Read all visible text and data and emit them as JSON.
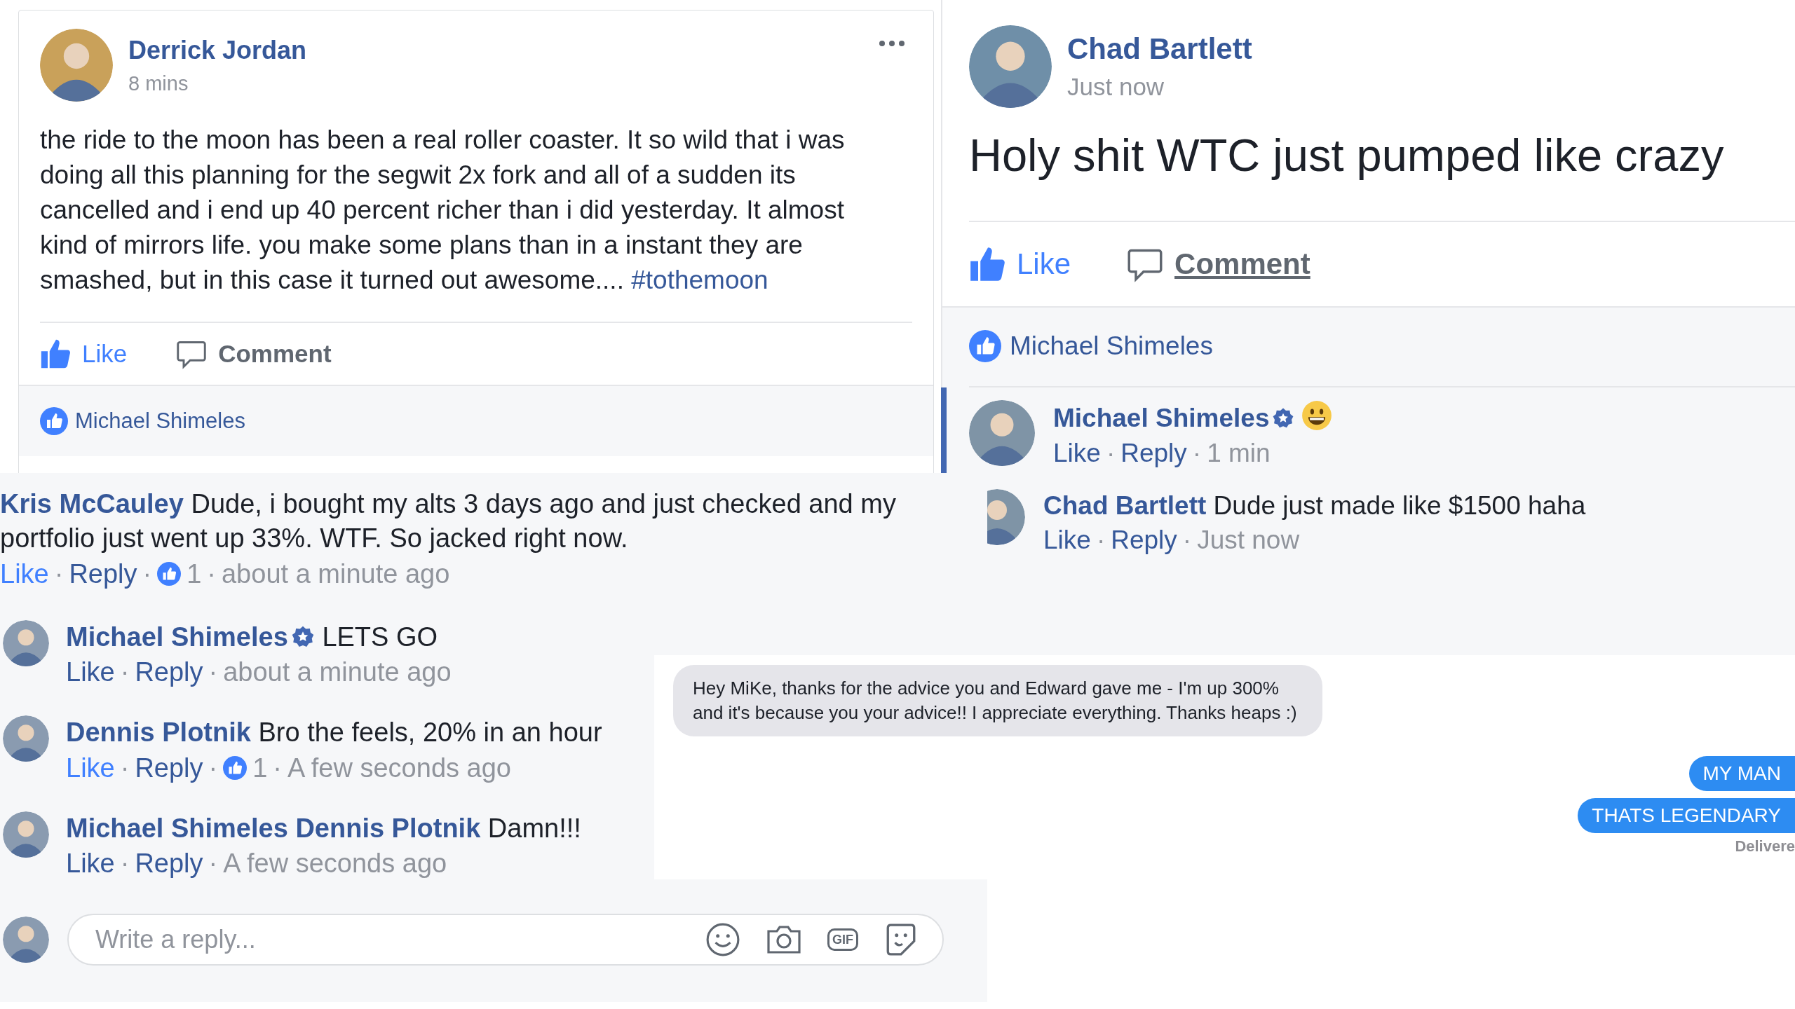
{
  "separator": "·",
  "post_1": {
    "author": "Derrick Jordan",
    "time": "8 mins",
    "text": "the ride to the moon has been a real roller coaster. It so wild that i was doing all this planning for the segwit 2x fork and all of a sudden its cancelled and i end up 40 percent richer than i did yesterday. It almost kind of mirrors life. you make some plans than in a instant they are smashed, but in this case it turned out awesome....",
    "hashtag": "#tothemoon",
    "like_label": "Like",
    "liked": true,
    "comment_label": "Comment",
    "comment_underlined": false,
    "likers": "Michael Shimeles"
  },
  "post_2": {
    "author": "Chad Bartlett",
    "time": "Just now",
    "text": "Holy shit WTC just pumped like crazy",
    "like_label": "Like",
    "liked": true,
    "comment_label": "Comment",
    "comment_underlined": true,
    "likers": "Michael Shimeles",
    "comments": [
      {
        "author": "Michael Shimeles",
        "verified": true,
        "emoji": true,
        "selected": true,
        "like_label": "Like",
        "liked": false,
        "reply_label": "Reply",
        "time": "1 min"
      },
      {
        "author": "Chad Bartlett",
        "verified": false,
        "emoji": false,
        "selected": false,
        "text": "Dude just made like $1500 haha",
        "like_label": "Like",
        "liked": false,
        "reply_label": "Reply",
        "time": "Just now"
      }
    ]
  },
  "thread": {
    "comments": [
      {
        "author": "Kris McCauley",
        "verified": false,
        "text": "Dude, i bought my alts 3 days ago and just checked and my portfolio just went up 33%. WTF. So jacked right now.",
        "like_label": "Like",
        "liked": true,
        "reply_label": "Reply",
        "reactions": "1",
        "time": "about a minute ago"
      },
      {
        "author": "Michael Shimeles",
        "verified": true,
        "text": "LETS GO",
        "like_label": "Like",
        "liked": false,
        "reply_label": "Reply",
        "time": "about a minute ago"
      },
      {
        "author": "Dennis Plotnik",
        "verified": false,
        "text": "Bro the feels, 20% in an hour",
        "like_label": "Like",
        "liked": true,
        "reply_label": "Reply",
        "reactions": "1",
        "time": "A few seconds ago"
      },
      {
        "author": "Michael Shimeles",
        "verified": false,
        "mention": "Dennis Plotnik",
        "text": "Damn!!!",
        "like_label": "Like",
        "liked": false,
        "reply_label": "Reply",
        "time": "A few seconds ago"
      }
    ],
    "reply": {
      "placeholder": "Write a reply...",
      "gif_label": "GIF"
    }
  },
  "chat": {
    "messages": [
      {
        "kind": "received",
        "text": "Hey MiKe, thanks for the advice you and Edward gave me - I'm up 300% and it's because you your advice!! I appreciate everything. Thanks heaps :)"
      },
      {
        "kind": "sent",
        "text": "MY MAN"
      },
      {
        "kind": "sent",
        "text": "THATS LEGENDARY"
      }
    ],
    "status": "Delivere"
  }
}
